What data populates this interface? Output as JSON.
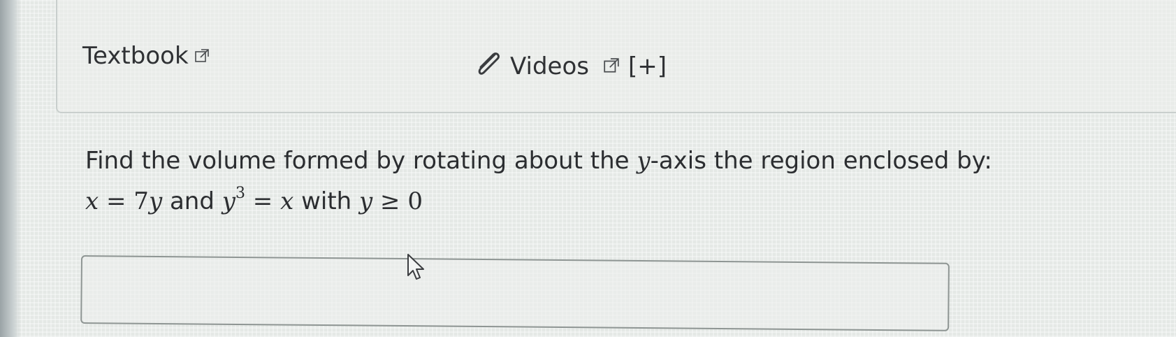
{
  "resources": {
    "textbook_label": "Textbook",
    "videos_label": "Videos",
    "expand_label": "[+]",
    "icons": {
      "external_link": "external-link-icon",
      "paperclip": "paperclip-icon"
    }
  },
  "question": {
    "line1_prefix": "Find the volume formed by rotating about the ",
    "line1_var": "y",
    "line1_suffix": "-axis the region enclosed by:",
    "eq1_lhs": "x",
    "eq1_op": " = ",
    "eq1_rhs_num": "7",
    "eq1_rhs_var": "y",
    "conj_and": " and ",
    "eq2_base": "y",
    "eq2_exp": "3",
    "eq2_op": " = ",
    "eq2_rhs": "x",
    "conj_with": " with ",
    "cond_var": "y",
    "cond_op": " ≥ ",
    "cond_val": "0"
  },
  "answer": {
    "value": "",
    "placeholder": ""
  },
  "colors": {
    "text": "#2b2d30",
    "border": "#8e9593",
    "background": "#e4e8e5"
  }
}
